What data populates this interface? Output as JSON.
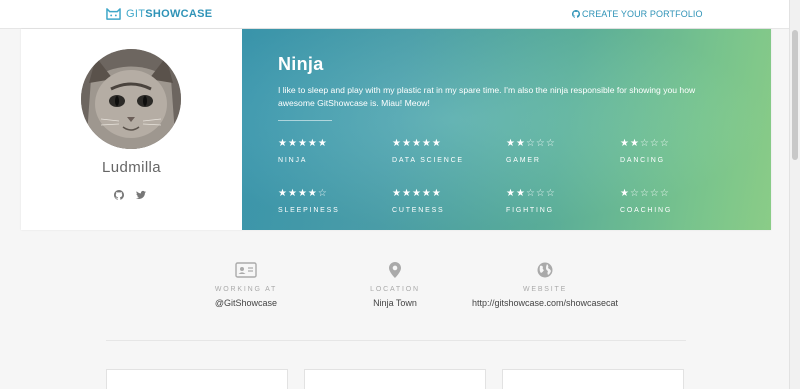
{
  "header": {
    "brand_light": "GIT",
    "brand_bold": "SHOWCASE",
    "cta_label": "CREATE YOUR PORTFOLIO"
  },
  "profile": {
    "name": "Ludmilla",
    "social_icons": [
      "github-icon",
      "twitter-icon"
    ],
    "bio_title": "Ninja",
    "bio_text": "I like to sleep and play with my plastic rat in my spare time. I'm also the ninja responsible for showing you how awesome GitShowcase is. Miau! Meow!",
    "skills": [
      {
        "label": "NINJA",
        "rating": 5,
        "max": 5
      },
      {
        "label": "DATA SCIENCE",
        "rating": 5,
        "max": 5
      },
      {
        "label": "GAMER",
        "rating": 2,
        "max": 5
      },
      {
        "label": "DANCING",
        "rating": 2,
        "max": 5
      },
      {
        "label": "SLEEPINESS",
        "rating": 4,
        "max": 5
      },
      {
        "label": "CUTENESS",
        "rating": 5,
        "max": 5
      },
      {
        "label": "FIGHTING",
        "rating": 2,
        "max": 5
      },
      {
        "label": "COACHING",
        "rating": 1,
        "max": 5
      }
    ]
  },
  "info": {
    "working_at_label": "WORKING AT",
    "working_at_value": "@GitShowcase",
    "location_label": "LOCATION",
    "location_value": "Ninja Town",
    "website_label": "WEBSITE",
    "website_value": "http://gitshowcase.com/showcasecat"
  },
  "colors": {
    "accent": "#2f93b7",
    "hero_start": "#3d9db5",
    "hero_end": "#93d98f"
  }
}
